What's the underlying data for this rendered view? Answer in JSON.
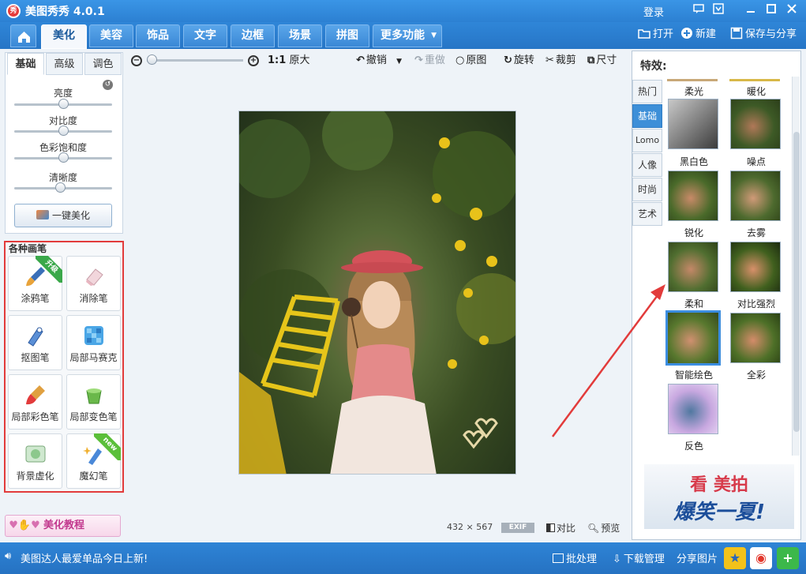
{
  "window": {
    "logo": "秀",
    "title": "美图秀秀 4.0.1",
    "login": "登录",
    "icons": [
      "chat-icon",
      "skin-icon",
      "minimize-icon",
      "maximize-icon",
      "close-icon"
    ]
  },
  "tabs": {
    "items": [
      "美化",
      "美容",
      "饰品",
      "文字",
      "边框",
      "场景",
      "拼图",
      "更多功能"
    ],
    "active": "美化"
  },
  "top_tools": {
    "open": "打开",
    "new": "新建",
    "save_share": "保存与分享"
  },
  "left": {
    "subtabs": [
      "基础",
      "高级",
      "调色"
    ],
    "sliders": [
      {
        "label": "亮度",
        "value": 0.5
      },
      {
        "label": "对比度",
        "value": 0.5
      },
      {
        "label": "色彩饱和度",
        "value": 0.5
      },
      {
        "label": "清晰度",
        "value": 0.47
      }
    ],
    "one_key": "一键美化",
    "brushes_title": "各种画笔",
    "brushes": [
      {
        "label": "涂鸦笔",
        "badge": "升级"
      },
      {
        "label": "消除笔"
      },
      {
        "label": "抠图笔"
      },
      {
        "label": "局部马赛克"
      },
      {
        "label": "局部彩色笔"
      },
      {
        "label": "局部变色笔"
      },
      {
        "label": "背景虚化"
      },
      {
        "label": "魔幻笔",
        "badge": "new"
      }
    ],
    "tutorial": "美化教程"
  },
  "toolbar": {
    "zoom_ratio": "1:1",
    "original_size": "原大",
    "undo": "撤销",
    "redo": "重做",
    "original": "原图",
    "rotate": "旋转",
    "crop": "裁剪",
    "size": "尺寸"
  },
  "canvas": {
    "dimensions": "432 × 567",
    "exif": "EXIF",
    "compare": "对比",
    "preview": "预览"
  },
  "effects": {
    "title": "特效:",
    "categories": [
      "热门",
      "基础",
      "Lomo",
      "人像",
      "时尚",
      "艺术"
    ],
    "active_category": "基础",
    "top_labels": [
      "柔光",
      "暖化"
    ],
    "items": [
      {
        "label": "黑白色"
      },
      {
        "label": "噪点"
      },
      {
        "label": "锐化"
      },
      {
        "label": "去雾"
      },
      {
        "label": "柔和"
      },
      {
        "label": "对比强烈"
      },
      {
        "label": "智能绘色",
        "selected": true
      },
      {
        "label": "全彩"
      },
      {
        "label": "反色"
      }
    ],
    "ad": {
      "line1": "看 美拍",
      "line2": "爆笑一夏!"
    }
  },
  "status": {
    "news": "美图达人最爱单品今日上新!",
    "batch": "批处理",
    "download": "下载管理",
    "share": "分享图片"
  },
  "colors": {
    "chrome_blue": "#2d7fd0",
    "accent_blue": "#3d8fd8",
    "highlight_red": "#e23b3b"
  }
}
